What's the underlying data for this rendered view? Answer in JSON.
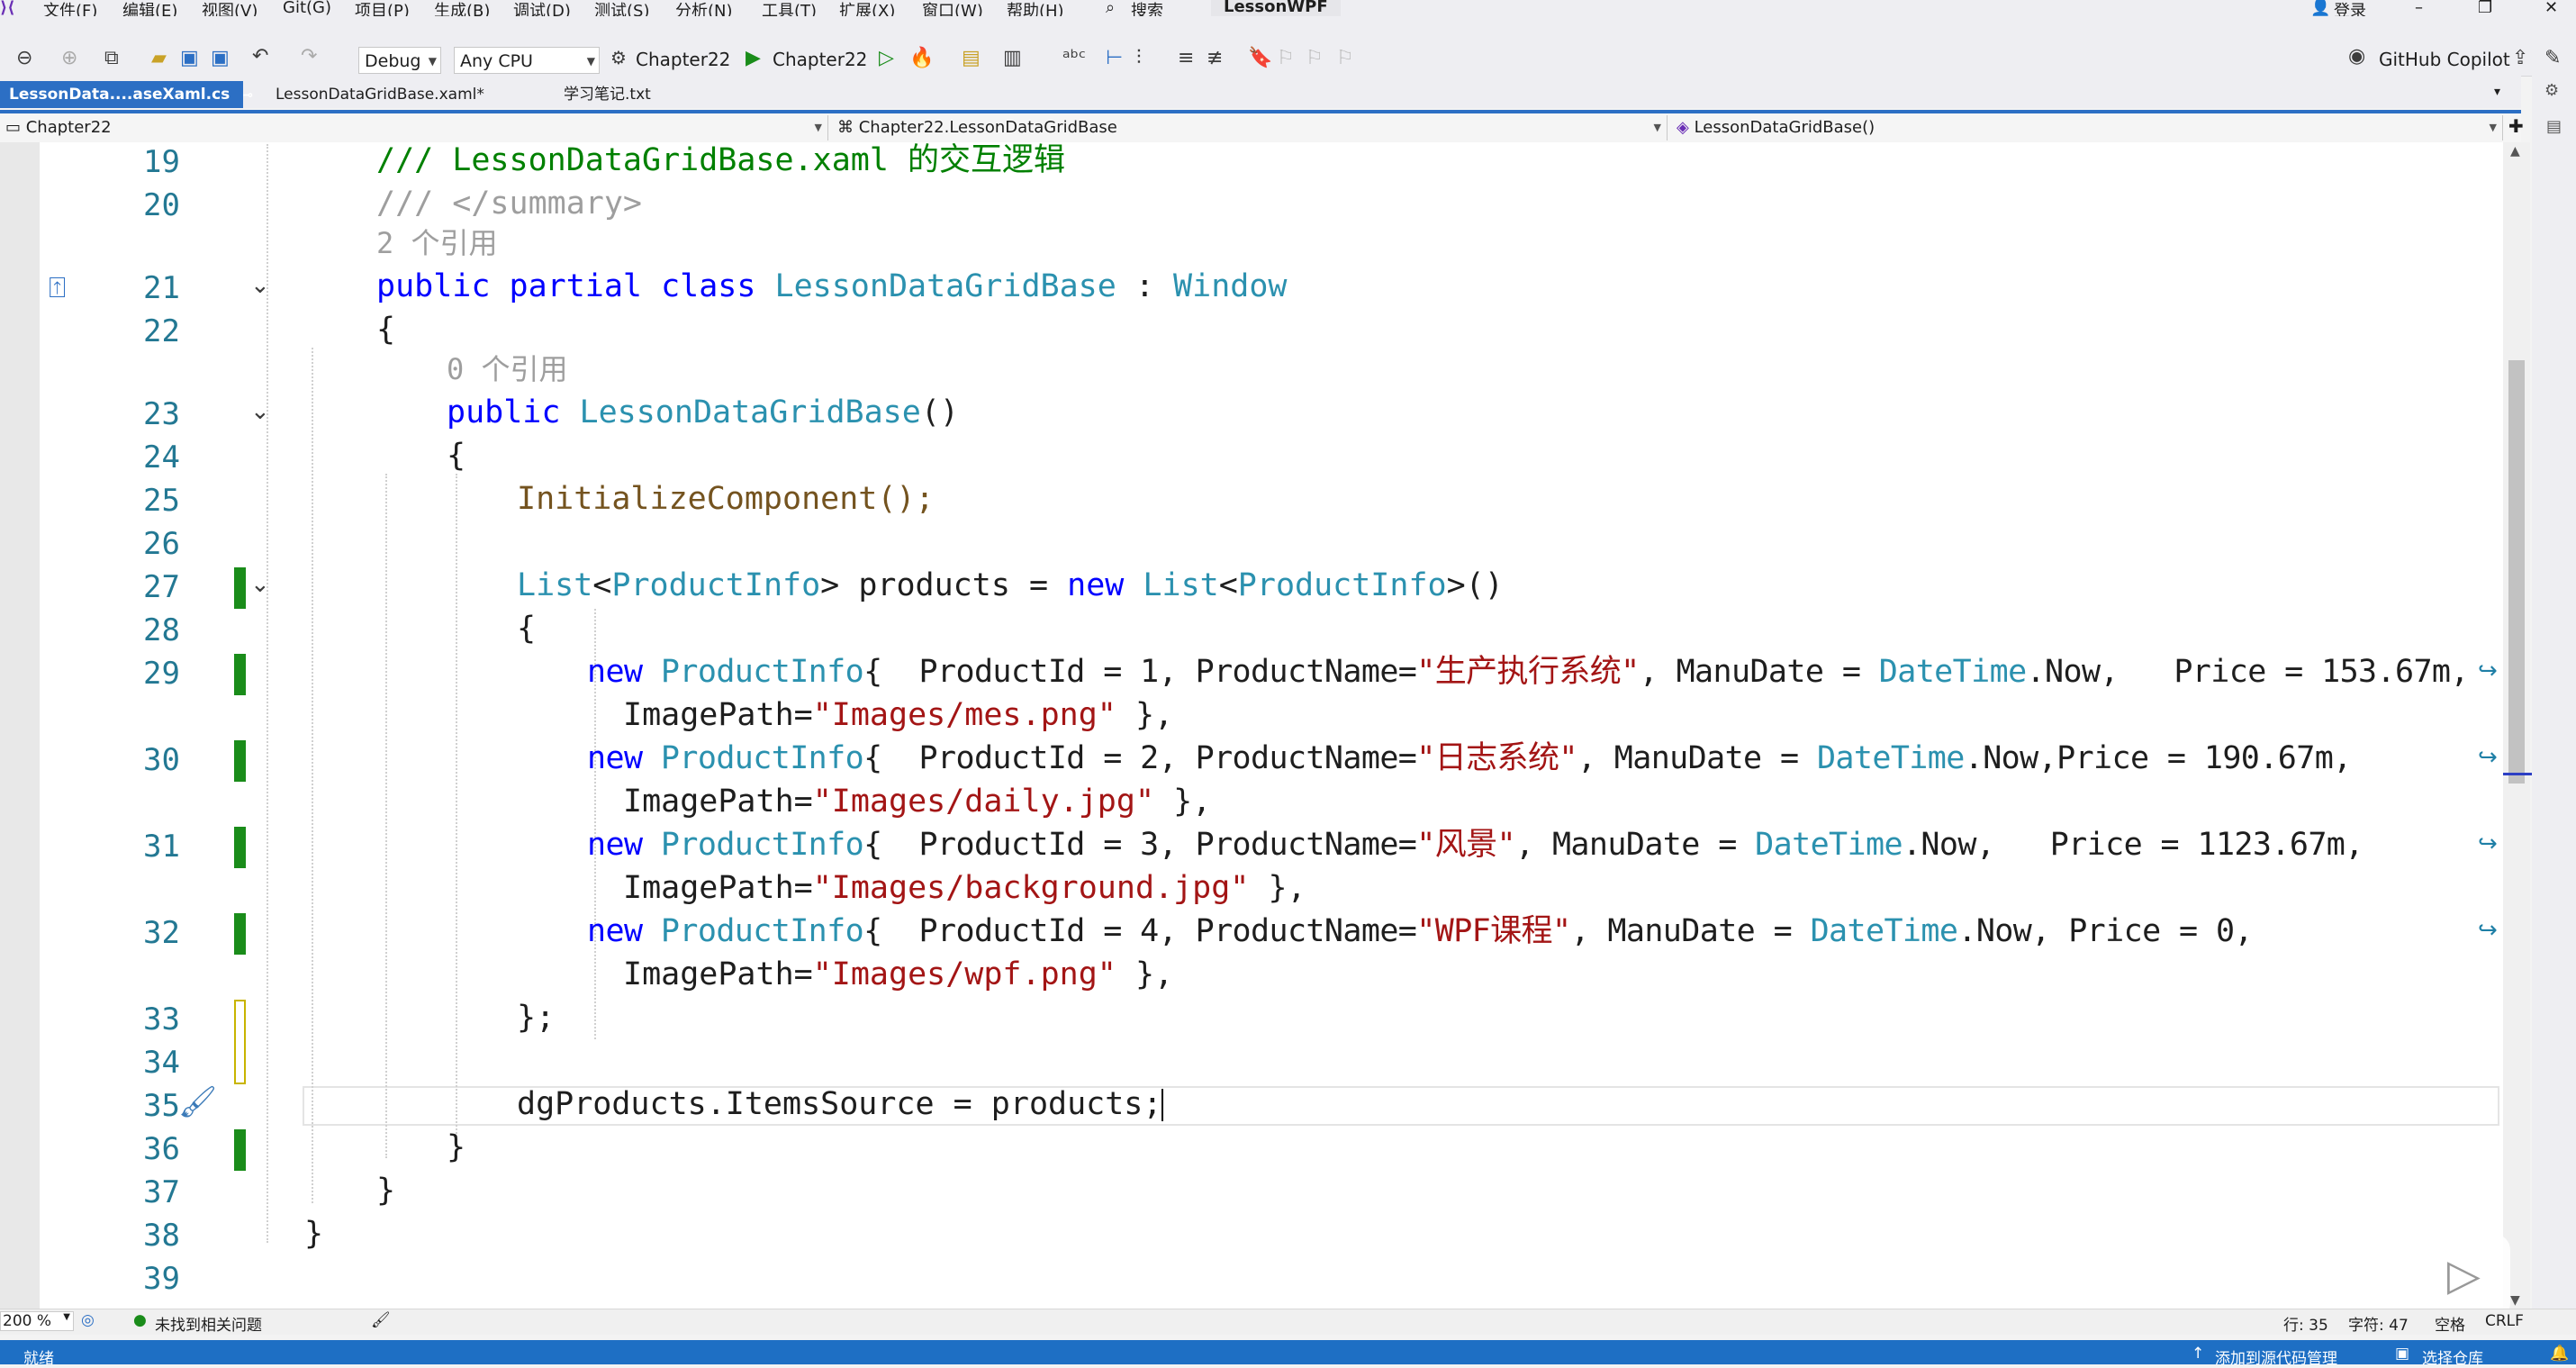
{
  "menu": {
    "items": [
      "文件(F)",
      "编辑(E)",
      "视图(V)",
      "Git(G)",
      "项目(P)",
      "生成(B)",
      "调试(D)",
      "测试(S)",
      "分析(N)",
      "工具(T)",
      "扩展(X)",
      "窗口(W)",
      "帮助(H)"
    ],
    "search": "搜索",
    "project_title": "LessonWPF",
    "login": "登录"
  },
  "toolbar": {
    "config": "Debug",
    "platform": "Any CPU",
    "startup_project": "Chapter22",
    "run_target": "Chapter22",
    "copilot": "GitHub Copilot"
  },
  "tabs": [
    {
      "label": "LessonData....aseXaml.cs"
    },
    {
      "label": "LessonDataGridBase.xaml*"
    },
    {
      "label": "学习笔记.txt"
    }
  ],
  "nav": {
    "project": "Chapter22",
    "class": "Chapter22.LessonDataGridBase",
    "member": "LessonDataGridBase()"
  },
  "code": {
    "l19": "/// LessonDataGridBase.xaml 的交互逻辑",
    "l20": "/// </summary>",
    "ref2": "2 个引用",
    "l21_kw": "public partial class",
    "l21_name": "LessonDataGridBase",
    "l21_colon": ":",
    "l21_base": "Window",
    "brace_open": "{",
    "brace_close": "}",
    "ref0": "0 个引用",
    "l23_kw": "public",
    "l23_name": "LessonDataGridBase",
    "l23_paren": "()",
    "l25": "InitializeComponent();",
    "l27_list": "List",
    "l27_lt": "<",
    "l27_type": "ProductInfo",
    "l27_gt": ">",
    "l27_var": "products =",
    "l27_new": "new",
    "l27_list2": "List",
    "l27_type2": "ProductInfo",
    "l27_end": ">()",
    "new": "new",
    "pi": "ProductInfo",
    "l29a": "{  ProductId = 1, ProductName=",
    "l29s": "\"生产执行系统\"",
    "l29b": ", ManuDate = ",
    "dt": "DateTime",
    "l29c": ".Now,   Price = 153.67m,",
    "l29d_pre": "ImagePath=",
    "l29d_s": "\"Images/mes.png\"",
    "l29d_post": " },",
    "l30a": "{  ProductId = 2, ProductName=",
    "l30s": "\"日志系统\"",
    "l30c": ".Now,Price = 190.67m,",
    "l30d_s": "\"Images/daily.jpg\"",
    "l31a": "{  ProductId = 3, ProductName=",
    "l31s": "\"风景\"",
    "l31c": ".Now,   Price = 1123.67m,",
    "l31d_s": "\"Images/background.jpg\"",
    "l32a": "{  ProductId = 4, ProductName=",
    "l32s": "\"WPF课程\"",
    "l32c": ".Now, Price = 0,",
    "l32d_s": "\"Images/wpf.png\"",
    "l33": "};",
    "l35": "dgProducts.ItemsSource = products;"
  },
  "line_numbers": [
    "19",
    "20",
    "21",
    "22",
    "23",
    "24",
    "25",
    "26",
    "27",
    "28",
    "29",
    "30",
    "31",
    "32",
    "33",
    "34",
    "35",
    "36",
    "37",
    "38",
    "39"
  ],
  "status": {
    "zoom": "200 %",
    "issues": "未找到相关问题",
    "line": "行: 35",
    "col": "字符: 47",
    "space": "空格",
    "eol": "CRLF",
    "ready": "就绪",
    "add_source": "添加到源代码管理",
    "select_repo": "选择仓库"
  }
}
